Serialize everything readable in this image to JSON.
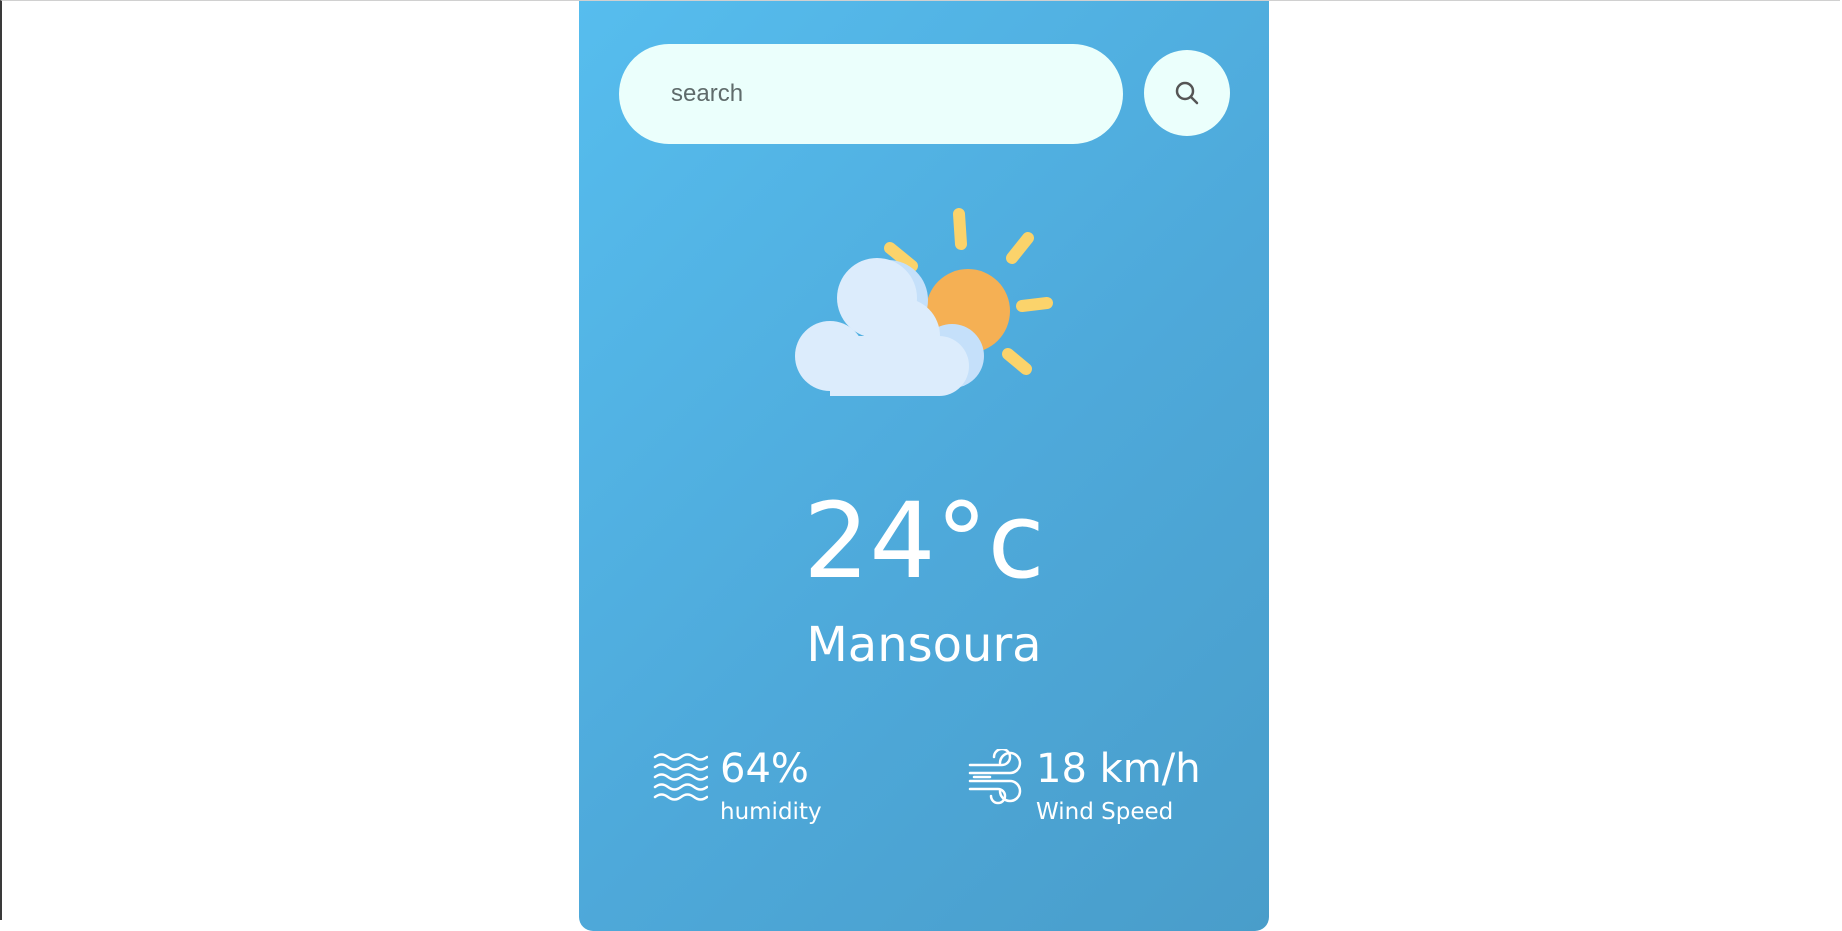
{
  "search": {
    "placeholder": "search",
    "value": "",
    "button_icon": "search-icon"
  },
  "weather": {
    "icon": "partly-cloudy-icon",
    "temperature": "24°c",
    "city": "Mansoura"
  },
  "details": {
    "humidity": {
      "icon": "humidity-waves-icon",
      "value": "64%",
      "label": "humidity"
    },
    "wind": {
      "icon": "wind-icon",
      "value": "18 km/h",
      "label": "Wind Speed"
    }
  },
  "colors": {
    "card_gradient_start": "#56bdee",
    "card_gradient_end": "#499dca",
    "search_bg": "#ebfffc",
    "sun": "#f5b054",
    "sun_rays": "#fbd36b",
    "cloud": "#dcecfc"
  }
}
